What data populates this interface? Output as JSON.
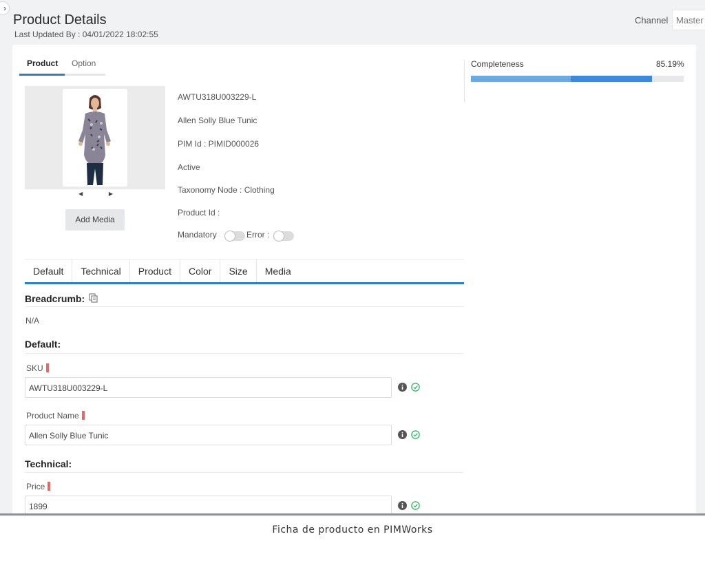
{
  "header": {
    "title": "Product Details",
    "last_updated": "Last Updated By : 04/01/2022 18:02:55",
    "channel_label": "Channel",
    "channel_value": "Master"
  },
  "product_tabs": [
    {
      "label": "Product",
      "active": true
    },
    {
      "label": "Option",
      "active": false
    }
  ],
  "media": {
    "add_media_label": "Add Media",
    "prev_arrow": "◀",
    "next_arrow": "▶"
  },
  "product_info": {
    "sku": "AWTU318U003229-L",
    "name": "Allen Solly Blue Tunic",
    "pim_id": "PIM Id : PIMID000026",
    "status": "Active",
    "taxonomy": "Taxonomy Node  : Clothing",
    "product_id": "Product Id :",
    "mandatory_label": "Mandatory",
    "error_label": "Error :"
  },
  "completeness": {
    "label": "Completeness",
    "value_text": "85.19%",
    "value": 0.8519
  },
  "attribute_tabs": [
    "Default",
    "Technical",
    "Product",
    "Color",
    "Size",
    "Media"
  ],
  "sections": {
    "breadcrumb_title": "Breadcrumb:",
    "breadcrumb_value": "N/A",
    "default_title": "Default:",
    "technical_title": "Technical:"
  },
  "fields": {
    "sku": {
      "label": "SKU",
      "value": "AWTU318U003229-L"
    },
    "product_name": {
      "label": "Product Name",
      "value": "Allen Solly Blue Tunic"
    },
    "price": {
      "label": "Price",
      "value": "1899"
    }
  },
  "caption": "Ficha de producto en PIMWorks",
  "colors": {
    "accent": "#2e7fc1",
    "required": "#e36a6a",
    "valid": "#3fb86e"
  }
}
